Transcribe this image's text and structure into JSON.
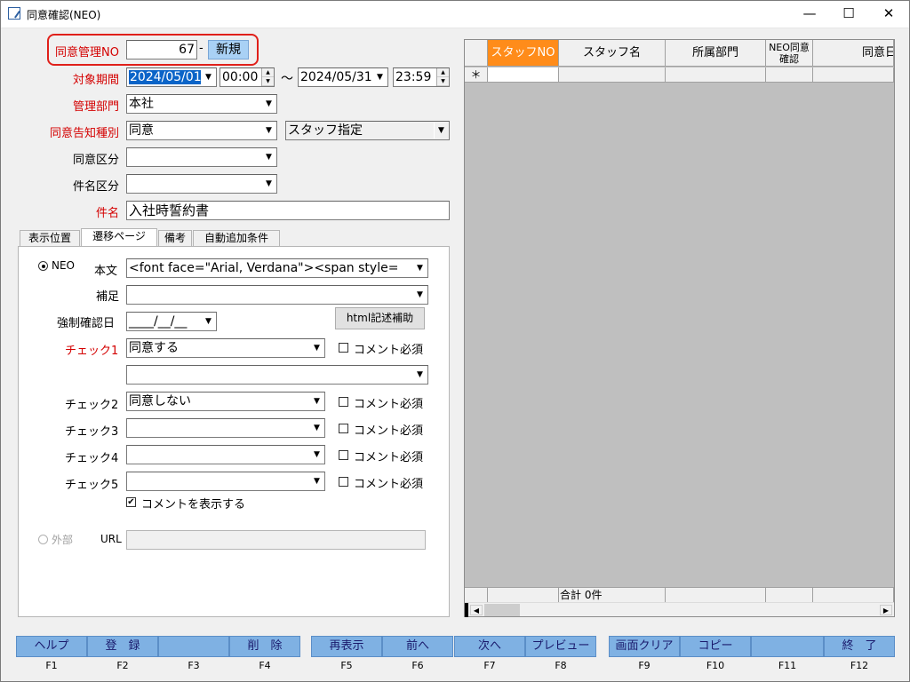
{
  "window": {
    "title": "同意確認(NEO)",
    "minimize": "—",
    "maximize": "☐",
    "close": "✕"
  },
  "form": {
    "mgmt_no_label": "同意管理NO",
    "mgmt_no_value": "67",
    "mgmt_no_sep": "-",
    "new_label": "新規",
    "period_label": "対象期間",
    "period_from_date": "2024/05/01",
    "period_from_time": "00:00",
    "period_tilde": "～",
    "period_to_date": "2024/05/31",
    "period_to_time": "23:59",
    "dept_label": "管理部門",
    "dept_value": "本社",
    "notice_type_label": "同意告知種別",
    "notice_type_value": "同意",
    "target_value": "スタッフ指定",
    "consent_class_label": "同意区分",
    "consent_class_value": "",
    "subject_class_label": "件名区分",
    "subject_class_value": "",
    "subject_label": "件名",
    "subject_value": "入社時誓約書"
  },
  "tabs": [
    "表示位置",
    "遷移ページ",
    "備考",
    "自動追加条件"
  ],
  "tab_panel": {
    "neo_label": "NEO",
    "body_label": "本文",
    "body_value": "<font face=\"Arial, Verdana\"><span style=",
    "supplement_label": "補足",
    "supplement_value": "",
    "forced_date_label": "強制確認日",
    "forced_date_value": "____/__/__",
    "html_help_button": "html記述補助",
    "checks": [
      {
        "label": "チェック1",
        "value": "同意する",
        "comment_label": "コメント必須"
      },
      {
        "label": "",
        "value": "",
        "comment_label": ""
      },
      {
        "label": "チェック2",
        "value": "同意しない",
        "comment_label": "コメント必須"
      },
      {
        "label": "チェック3",
        "value": "",
        "comment_label": "コメント必須"
      },
      {
        "label": "チェック4",
        "value": "",
        "comment_label": "コメント必須"
      },
      {
        "label": "チェック5",
        "value": "",
        "comment_label": "コメント必須"
      }
    ],
    "show_comment_label": "コメントを表示する",
    "external_label": "外部",
    "url_label": "URL",
    "url_value": ""
  },
  "grid": {
    "columns": [
      "スタッフNO",
      "スタッフ名",
      "所属部門",
      "NEO同意確認",
      "同意日"
    ],
    "new_row_marker": "＊",
    "footer_total": "合計 0件"
  },
  "function_keys": [
    {
      "label": "ヘルプ",
      "key": "F1"
    },
    {
      "label": "登　録",
      "key": "F2"
    },
    {
      "label": "",
      "key": "F3"
    },
    {
      "label": "削　除",
      "key": "F4"
    },
    {
      "label": "再表示",
      "key": "F5"
    },
    {
      "label": "前へ",
      "key": "F6"
    },
    {
      "label": "次へ",
      "key": "F7"
    },
    {
      "label": "プレビュー",
      "key": "F8"
    },
    {
      "label": "画面クリア",
      "key": "F9"
    },
    {
      "label": "コピー",
      "key": "F10"
    },
    {
      "label": "",
      "key": "F11"
    },
    {
      "label": "終　了",
      "key": "F12"
    }
  ],
  "colors": {
    "required_label": "#d40000",
    "highlight_box": "#e0201a",
    "grid_header_selected": "#ff8c1a",
    "function_key": "#7fb1e3"
  }
}
